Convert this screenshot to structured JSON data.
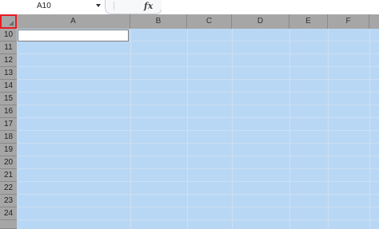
{
  "name_box": {
    "value": "A10"
  },
  "formula_bar": {
    "fx_label": "fx",
    "value": ""
  },
  "columns": [
    "A",
    "B",
    "C",
    "D",
    "E",
    "F"
  ],
  "rows": [
    "10",
    "11",
    "12",
    "13",
    "14",
    "15",
    "16",
    "17",
    "18",
    "19",
    "20",
    "21",
    "22",
    "23",
    "24"
  ],
  "selection": {
    "active_cell": "A10"
  },
  "colors": {
    "selection": "#b8d7f5",
    "header": "#a6a6a6",
    "corner_highlight": "#e81c23"
  }
}
